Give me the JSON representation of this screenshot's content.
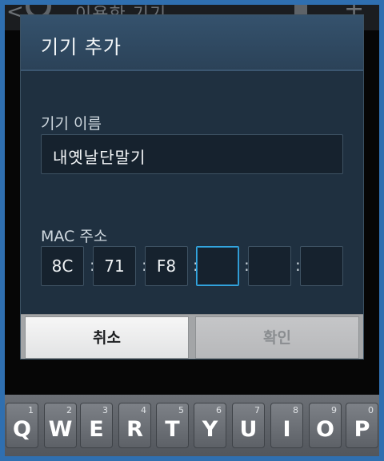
{
  "background_app": {
    "title": "이용한 기기"
  },
  "dialog": {
    "title": "기기 추가",
    "device_name_label": "기기 이름",
    "device_name_value": "내옛날단말기",
    "mac_label": "MAC 주소",
    "mac_fields": [
      "8C",
      "71",
      "F8",
      "",
      "",
      ""
    ],
    "cancel_label": "취소",
    "ok_label": "확인"
  },
  "keyboard": {
    "keys": [
      {
        "letter": "Q",
        "number": "1"
      },
      {
        "letter": "W",
        "number": "2"
      },
      {
        "letter": "E",
        "number": "3"
      },
      {
        "letter": "R",
        "number": "4"
      },
      {
        "letter": "T",
        "number": "5"
      },
      {
        "letter": "Y",
        "number": "6"
      },
      {
        "letter": "U",
        "number": "7"
      },
      {
        "letter": "I",
        "number": "8"
      },
      {
        "letter": "O",
        "number": "9"
      },
      {
        "letter": "P",
        "number": "0"
      }
    ]
  },
  "colors": {
    "dialog_bg": "#1f3040",
    "focus_accent": "#33a6e0",
    "frame": "#2f6fb0"
  }
}
